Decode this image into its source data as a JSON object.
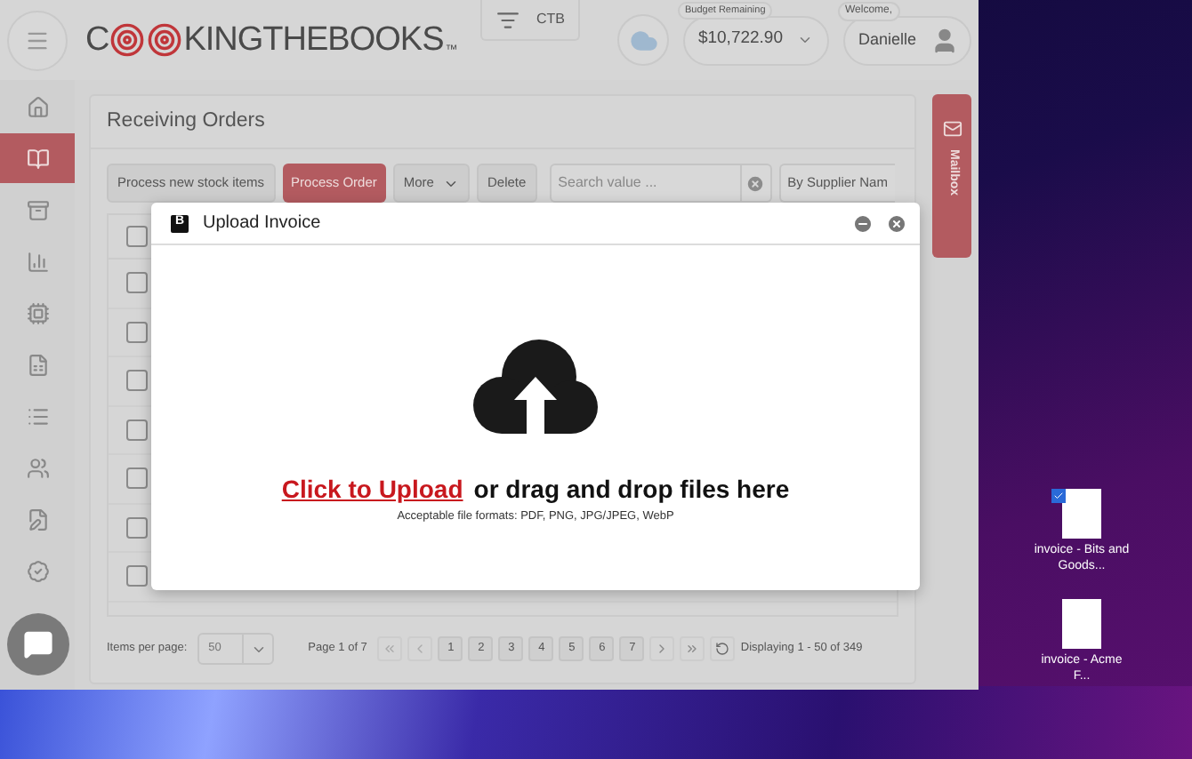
{
  "header": {
    "logo_start": "C",
    "logo_end": "KINGTHEBOOKS",
    "trademark": "™",
    "store": "CTB",
    "budget": {
      "label": "Budget Remaining",
      "value": "$10,722.90"
    },
    "user": {
      "label": "Welcome,",
      "name": "Danielle"
    }
  },
  "sidebar": {
    "items": [
      {
        "kind": "home",
        "selected": false
      },
      {
        "kind": "orders",
        "selected": true
      },
      {
        "kind": "recipes",
        "selected": false
      },
      {
        "kind": "reports",
        "selected": false
      },
      {
        "kind": "inventory",
        "selected": false
      },
      {
        "kind": "documents",
        "selected": false
      },
      {
        "kind": "menu",
        "selected": false
      },
      {
        "kind": "staff",
        "selected": false
      },
      {
        "kind": "notes",
        "selected": false
      },
      {
        "kind": "account",
        "selected": false
      }
    ]
  },
  "panel": {
    "title": "Receiving Orders",
    "toolbar": [
      {
        "kind": "button",
        "label": "Process new stock items"
      },
      {
        "kind": "primary",
        "label": "Process Order"
      },
      {
        "kind": "dropdown",
        "label": "More"
      },
      {
        "kind": "button",
        "label": "Delete"
      }
    ],
    "search": {
      "placeholder": "Search value ..."
    },
    "sort": "By Supplier Nam",
    "header_checked": false,
    "rows": [
      {
        "checked": false
      },
      {
        "checked": false
      },
      {
        "checked": false
      },
      {
        "checked": false
      },
      {
        "checked": false
      },
      {
        "checked": false
      },
      {
        "checked": false
      }
    ],
    "pagination": {
      "label": "Items per page:",
      "per_page": "50",
      "page_info": "Page 1 of 7",
      "pages": [
        {
          "label": "1",
          "selected": false
        },
        {
          "label": "2",
          "selected": false
        },
        {
          "label": "3",
          "selected": false
        },
        {
          "label": "4",
          "selected": false
        },
        {
          "label": "5",
          "selected": false
        },
        {
          "label": "6",
          "selected": false
        },
        {
          "label": "7",
          "selected": false
        }
      ],
      "summary": "Displaying 1 - 50 of 349"
    }
  },
  "mailbox": {
    "label": "Mailbox"
  },
  "modal": {
    "badge": "B",
    "title": "Upload Invoice",
    "link": "Click to Upload",
    "text": "or drag and drop files here",
    "formats": "Acceptable file formats: PDF, PNG, JPG/JPEG, WebP"
  },
  "desktop": {
    "files": [
      {
        "name": "invoice - Bits and Goods...",
        "selected": true
      },
      {
        "name": "invoice - Acme F...",
        "selected": false
      }
    ]
  }
}
